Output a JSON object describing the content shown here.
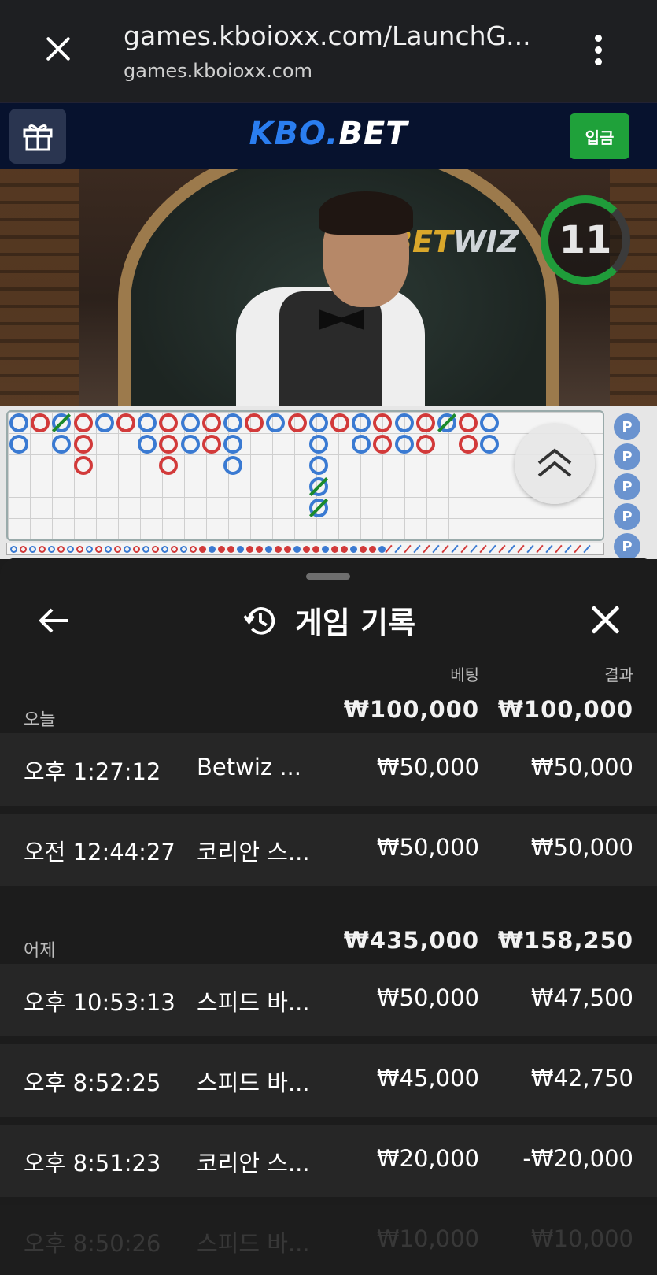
{
  "browser": {
    "url_title": "games.kboioxx.com/LaunchG...",
    "url_host": "games.kboioxx.com"
  },
  "site": {
    "logo_part1": "KBO.",
    "logo_part2": "BET",
    "deposit_label": "입금"
  },
  "video": {
    "table_brand_1": "BET",
    "table_brand_2": "WIZ",
    "timer": "11",
    "timer_remaining_fraction": 0.75
  },
  "roadmap": {
    "chip_label": "P"
  },
  "sheet": {
    "title": "게임 기록",
    "col_bet": "베팅",
    "col_result": "결과",
    "groups": [
      {
        "label": "오늘",
        "bet_total": "₩100,000",
        "result_total": "₩100,000",
        "entries": [
          {
            "time": "오후 1:27:12",
            "game": "Betwiz ...",
            "bet": "₩50,000",
            "result": "₩50,000"
          },
          {
            "time": "오전 12:44:27",
            "game": "코리안 스...",
            "bet": "₩50,000",
            "result": "₩50,000"
          }
        ]
      },
      {
        "label": "어제",
        "bet_total": "₩435,000",
        "result_total": "₩158,250",
        "entries": [
          {
            "time": "오후 10:53:13",
            "game": "스피드 바...",
            "bet": "₩50,000",
            "result": "₩47,500"
          },
          {
            "time": "오후 8:52:25",
            "game": "스피드 바...",
            "bet": "₩45,000",
            "result": "₩42,750"
          },
          {
            "time": "오후 8:51:23",
            "game": "코리안 스...",
            "bet": "₩20,000",
            "result": "-₩20,000"
          },
          {
            "time": "오후 8:50:26",
            "game": "스피드 바...",
            "bet": "₩10,000",
            "result": "₩10,000"
          }
        ]
      }
    ]
  },
  "colors": {
    "deposit_green": "#1fa13a",
    "timer_green": "#1f9c3a",
    "banker_red": "#d23a3a",
    "player_blue": "#3a7ad2",
    "sheet_bg": "#1c1c1c",
    "row_bg": "#262626"
  },
  "icons": {
    "close": "close-icon",
    "menu": "kebab-menu-icon",
    "gift": "gift-icon",
    "back": "arrow-left-icon",
    "history": "history-icon",
    "sheet_close": "close-icon",
    "collapse": "double-chevron-up-icon"
  }
}
